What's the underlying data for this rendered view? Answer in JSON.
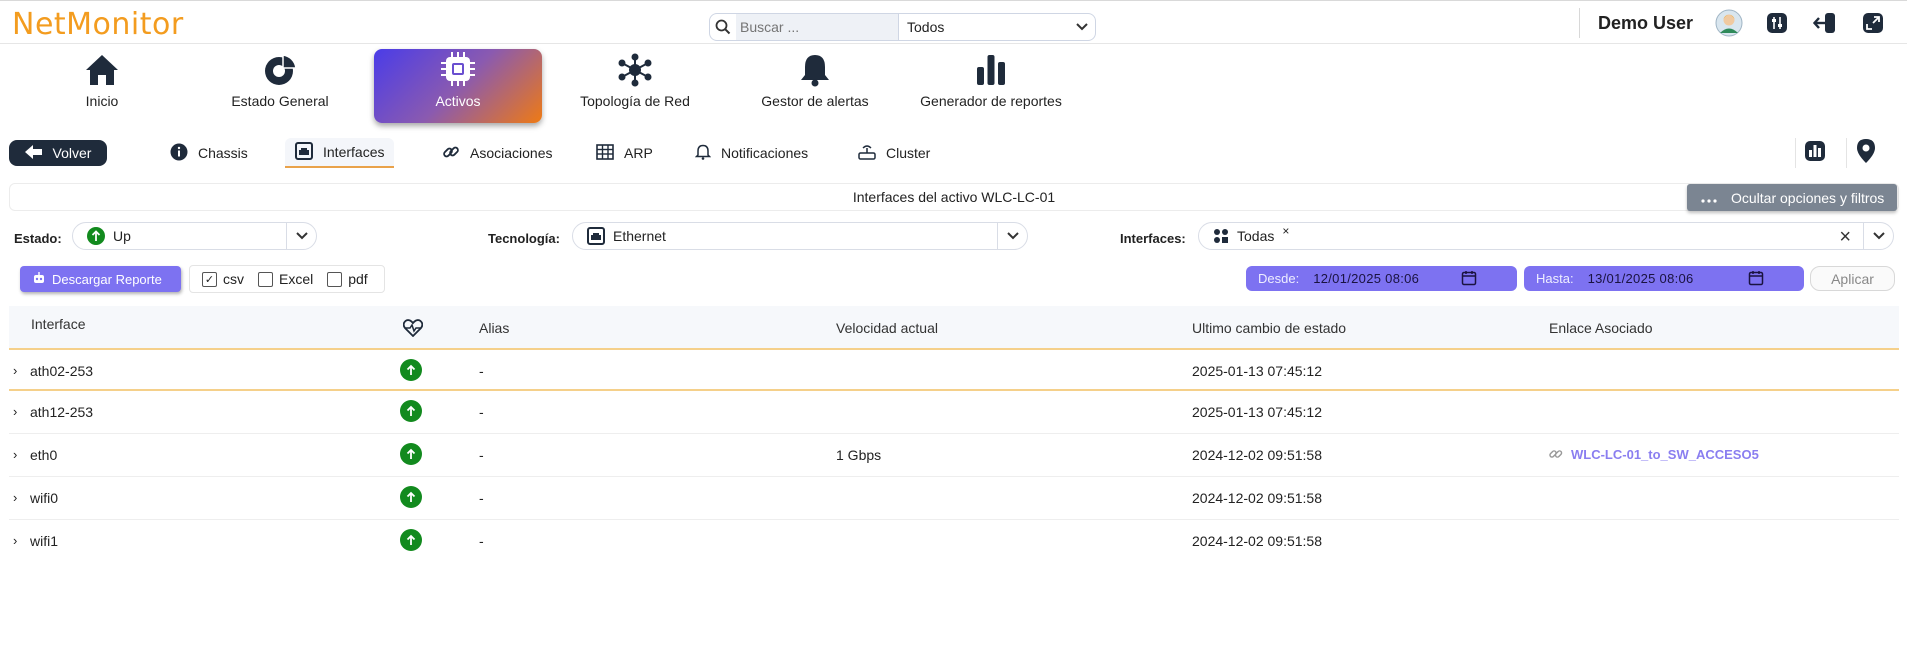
{
  "app": {
    "logo": "NetMonitor"
  },
  "search": {
    "placeholder": "Buscar ...",
    "scope": "Todos"
  },
  "user": {
    "name": "Demo User"
  },
  "mainnav": {
    "items": [
      {
        "label": "Inicio",
        "icon": "home-icon"
      },
      {
        "label": "Estado General",
        "icon": "pie-chart-icon"
      },
      {
        "label": "Activos",
        "icon": "chip-icon"
      },
      {
        "label": "Topología de Red",
        "icon": "network-icon"
      },
      {
        "label": "Gestor de alertas",
        "icon": "bell-icon"
      },
      {
        "label": "Generador de reportes",
        "icon": "bar-chart-icon"
      }
    ]
  },
  "subnav": {
    "back": "Volver",
    "tabs": [
      {
        "label": "Chassis",
        "icon": "info-icon"
      },
      {
        "label": "Interfaces",
        "icon": "ethernet-icon"
      },
      {
        "label": "Asociaciones",
        "icon": "link-icon"
      },
      {
        "label": "ARP",
        "icon": "table-icon"
      },
      {
        "label": "Notificaciones",
        "icon": "bell-icon"
      },
      {
        "label": "Cluster",
        "icon": "router-icon"
      }
    ]
  },
  "section": {
    "title": "Interfaces del activo WLC-LC-01",
    "hide_filters": "Ocultar opciones y filtros"
  },
  "filters": {
    "estado_label": "Estado:",
    "estado_value": "Up",
    "tecnologia_label": "Tecnología:",
    "tecnologia_value": "Ethernet",
    "interfaces_label": "Interfaces:",
    "interfaces_value": "Todas"
  },
  "report": {
    "download": "Descargar Reporte",
    "formats": [
      {
        "label": "csv",
        "checked": true
      },
      {
        "label": "Excel",
        "checked": false
      },
      {
        "label": "pdf",
        "checked": false
      }
    ]
  },
  "dates": {
    "from_label": "Desde:",
    "from_value": "12/01/2025 08:06",
    "to_label": "Hasta:",
    "to_value": "13/01/2025 08:06",
    "apply": "Aplicar"
  },
  "table": {
    "headers": {
      "interface": "Interface",
      "alias": "Alias",
      "speed": "Velocidad actual",
      "last_change": "Ultimo cambio de estado",
      "link": "Enlace Asociado"
    },
    "rows": [
      {
        "name": "ath02-253",
        "status": "up",
        "alias": "-",
        "speed": "",
        "last_change": "2025-01-13 07:45:12",
        "link": ""
      },
      {
        "name": "ath12-253",
        "status": "up",
        "alias": "-",
        "speed": "",
        "last_change": "2025-01-13 07:45:12",
        "link": ""
      },
      {
        "name": "eth0",
        "status": "up",
        "alias": "-",
        "speed": "1 Gbps",
        "last_change": "2024-12-02 09:51:58",
        "link": "WLC-LC-01_to_SW_ACCESO5"
      },
      {
        "name": "wifi0",
        "status": "up",
        "alias": "-",
        "speed": "",
        "last_change": "2024-12-02 09:51:58",
        "link": ""
      },
      {
        "name": "wifi1",
        "status": "up",
        "alias": "-",
        "speed": "",
        "last_change": "2024-12-02 09:51:58",
        "link": ""
      }
    ]
  },
  "colors": {
    "brand": "#f39c1f",
    "accent": "#7d72f1",
    "status_up": "#128a1e",
    "dark": "#1f2b3b"
  }
}
